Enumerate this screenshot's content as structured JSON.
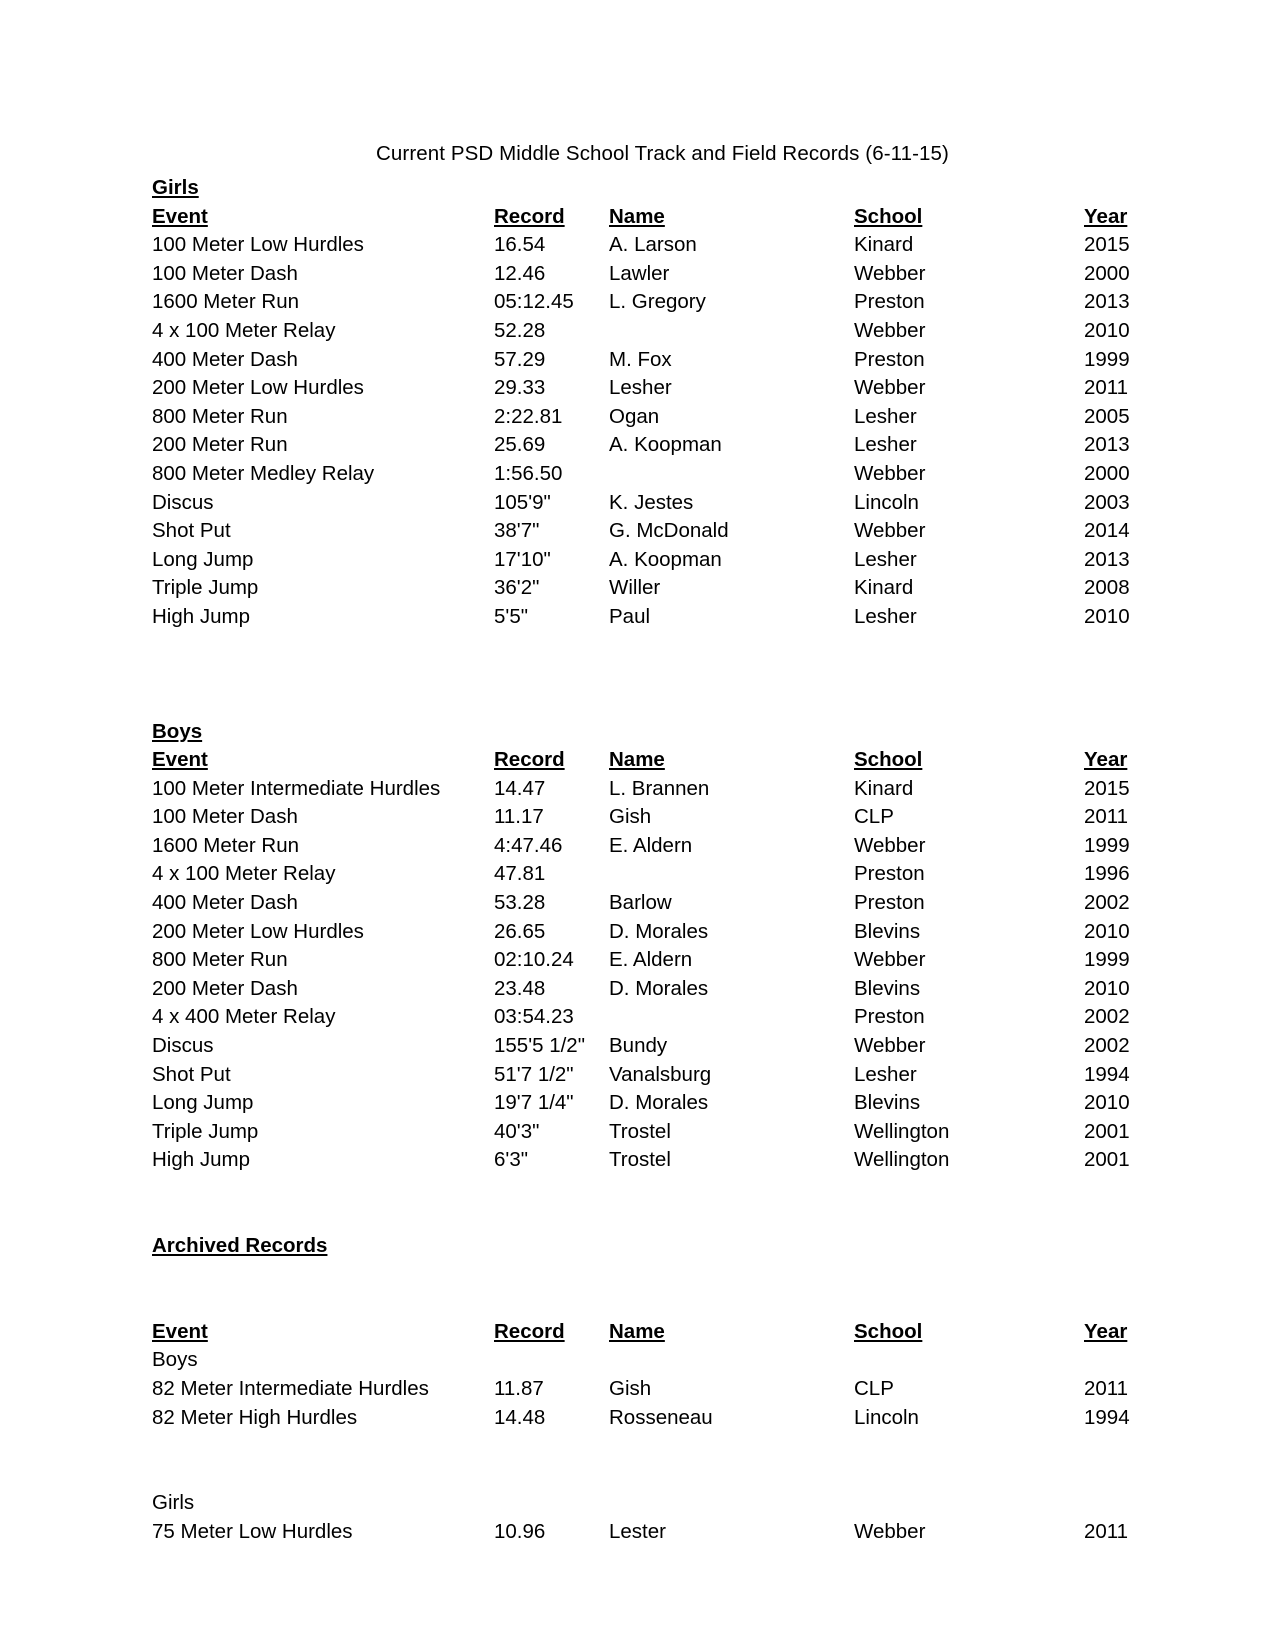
{
  "document": {
    "title": "Current PSD Middle School Track and Field Records (6-11-15)"
  },
  "columns": {
    "event": "Event",
    "record": "Record",
    "name": "Name",
    "school": "School",
    "year": "Year"
  },
  "sections": [
    {
      "heading": "Girls",
      "rows": [
        {
          "event": "100 Meter Low Hurdles",
          "record": "16.54",
          "name": "A. Larson",
          "school": "Kinard",
          "year": "2015"
        },
        {
          "event": "100 Meter Dash",
          "record": "12.46",
          "name": "Lawler",
          "school": "Webber",
          "year": "2000"
        },
        {
          "event": "1600 Meter Run",
          "record": "05:12.45",
          "name": "L. Gregory",
          "school": "Preston",
          "year": "2013"
        },
        {
          "event": "4 x 100 Meter Relay",
          "record": "52.28",
          "name": "",
          "school": "Webber",
          "year": "2010"
        },
        {
          "event": "400 Meter Dash",
          "record": "57.29",
          "name": "M. Fox",
          "school": "Preston",
          "year": "1999"
        },
        {
          "event": "200 Meter Low Hurdles",
          "record": "29.33",
          "name": "Lesher",
          "school": "Webber",
          "year": "2011"
        },
        {
          "event": "800 Meter Run",
          "record": "2:22.81",
          "name": "Ogan",
          "school": "Lesher",
          "year": "2005"
        },
        {
          "event": "200 Meter Run",
          "record": "25.69",
          "name": "A. Koopman",
          "school": "Lesher",
          "year": "2013"
        },
        {
          "event": "800 Meter Medley Relay",
          "record": "1:56.50",
          "name": "",
          "school": "Webber",
          "year": "2000"
        },
        {
          "event": "Discus",
          "record": "105'9\"",
          "name": "K. Jestes",
          "school": "Lincoln",
          "year": "2003"
        },
        {
          "event": "Shot Put",
          "record": "38'7\"",
          "name": "G. McDonald",
          "school": "Webber",
          "year": "2014"
        },
        {
          "event": "Long Jump",
          "record": "17'10\"",
          "name": "A. Koopman",
          "school": "Lesher",
          "year": "2013"
        },
        {
          "event": "Triple Jump",
          "record": "36'2\"",
          "name": "Willer",
          "school": "Kinard",
          "year": "2008"
        },
        {
          "event": "High Jump",
          "record": "5'5\"",
          "name": "Paul",
          "school": "Lesher",
          "year": "2010"
        }
      ]
    },
    {
      "heading": "Boys",
      "rows": [
        {
          "event": "100 Meter Intermediate Hurdles",
          "record": "14.47",
          "name": "L. Brannen",
          "school": "Kinard",
          "year": "2015"
        },
        {
          "event": "100 Meter Dash",
          "record": "11.17",
          "name": "Gish",
          "school": "CLP",
          "year": "2011"
        },
        {
          "event": "1600 Meter Run",
          "record": "4:47.46",
          "name": "E. Aldern",
          "school": "Webber",
          "year": "1999"
        },
        {
          "event": "4 x 100 Meter Relay",
          "record": "47.81",
          "name": "",
          "school": "Preston",
          "year": "1996"
        },
        {
          "event": "400 Meter Dash",
          "record": "53.28",
          "name": "Barlow",
          "school": "Preston",
          "year": "2002"
        },
        {
          "event": "200 Meter Low Hurdles",
          "record": "26.65",
          "name": "D. Morales",
          "school": "Blevins",
          "year": "2010"
        },
        {
          "event": "800 Meter Run",
          "record": "02:10.24",
          "name": "E. Aldern",
          "school": "Webber",
          "year": "1999"
        },
        {
          "event": "200 Meter Dash",
          "record": "23.48",
          "name": "D. Morales",
          "school": "Blevins",
          "year": "2010"
        },
        {
          "event": "4 x 400 Meter Relay",
          "record": "03:54.23",
          "name": "",
          "school": "Preston",
          "year": "2002"
        },
        {
          "event": "Discus",
          "record": "155'5 1/2\"",
          "name": "Bundy",
          "school": "Webber",
          "year": "2002"
        },
        {
          "event": "Shot Put",
          "record": "51'7 1/2\"",
          "name": "Vanalsburg",
          "school": "Lesher",
          "year": "1994"
        },
        {
          "event": "Long Jump",
          "record": "19'7 1/4\"",
          "name": "D. Morales",
          "school": "Blevins",
          "year": "2010"
        },
        {
          "event": "Triple Jump",
          "record": "40'3\"",
          "name": "Trostel",
          "school": "Wellington",
          "year": "2001"
        },
        {
          "event": "High Jump",
          "record": "6'3\"",
          "name": "Trostel",
          "school": "Wellington",
          "year": "2001"
        }
      ]
    }
  ],
  "archived": {
    "heading": "Archived Records",
    "groups": [
      {
        "label": "Boys",
        "rows": [
          {
            "event": "82 Meter Intermediate Hurdles",
            "record": "11.87",
            "name": "Gish",
            "school": "CLP",
            "year": "2011"
          },
          {
            "event": "82 Meter High Hurdles",
            "record": "14.48",
            "name": "Rosseneau",
            "school": "Lincoln",
            "year": "1994"
          }
        ]
      },
      {
        "label": "Girls",
        "rows": [
          {
            "event": "75 Meter Low Hurdles",
            "record": "10.96",
            "name": "Lester",
            "school": "Webber",
            "year": "2011"
          }
        ]
      }
    ]
  }
}
